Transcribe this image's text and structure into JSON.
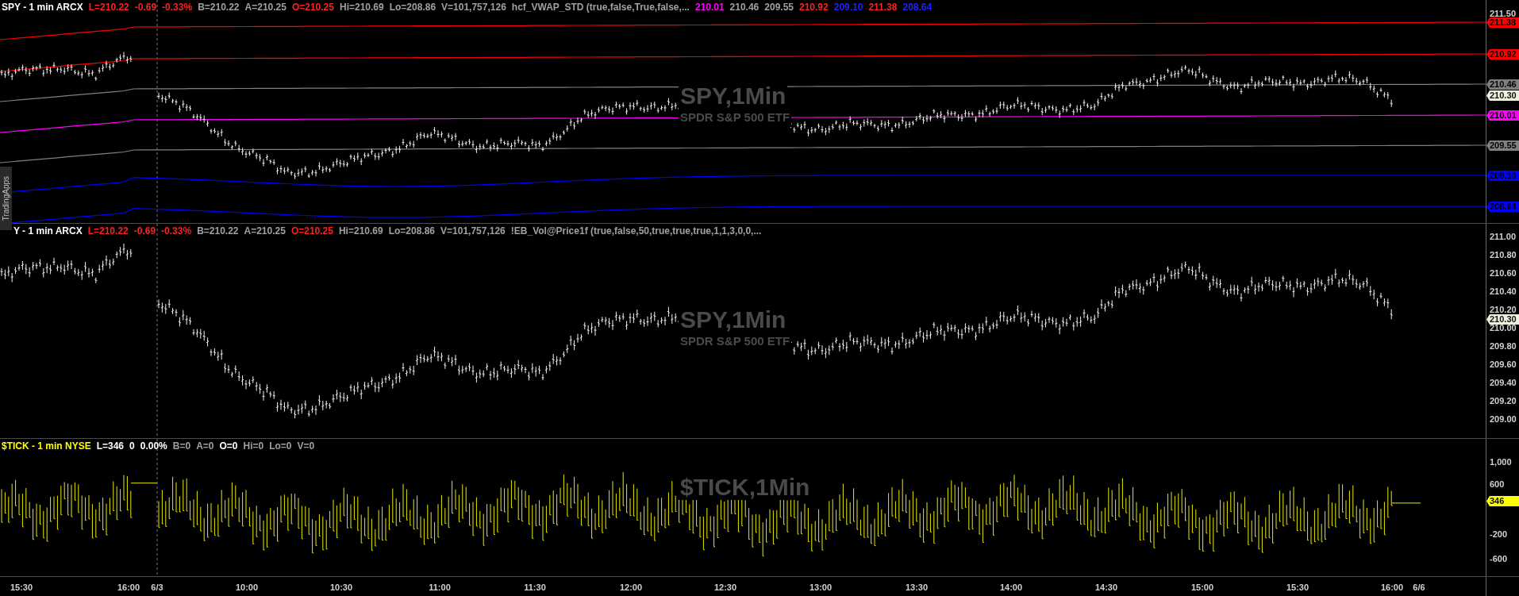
{
  "side_tab": "TradingApps",
  "panels": [
    {
      "header": [
        {
          "text": "SPY - 1 min  ARCX",
          "color": "#ffffff"
        },
        {
          "text": "L=210.22",
          "color": "#ff2020"
        },
        {
          "text": "-0.69",
          "color": "#ff2020"
        },
        {
          "text": "-0.33%",
          "color": "#ff2020"
        },
        {
          "text": "B=210.22",
          "color": "#a0a0a0"
        },
        {
          "text": "A=210.25",
          "color": "#a0a0a0"
        },
        {
          "text": "O=210.25",
          "color": "#ff2020"
        },
        {
          "text": "Hi=210.69",
          "color": "#a0a0a0"
        },
        {
          "text": "Lo=208.86",
          "color": "#a0a0a0"
        },
        {
          "text": "V=101,757,126",
          "color": "#a0a0a0"
        },
        {
          "text": "hcf_VWAP_STD (true,false,True,false,...",
          "color": "#a0a0a0"
        },
        {
          "text": "210.01",
          "color": "#ff00ff"
        },
        {
          "text": "210.46",
          "color": "#a0a0a0"
        },
        {
          "text": "209.55",
          "color": "#a0a0a0"
        },
        {
          "text": "210.92",
          "color": "#ff2020"
        },
        {
          "text": "209.10",
          "color": "#2020ff"
        },
        {
          "text": "211.38",
          "color": "#ff2020"
        },
        {
          "text": "208.64",
          "color": "#2020ff"
        }
      ],
      "watermark": {
        "symbol": "SPY,1Min",
        "description": "SPDR S&P 500 ETF"
      },
      "axis_labels": [
        "211.50"
      ],
      "price_tags": [
        {
          "text": "211.38",
          "color": "#ff0000",
          "kind": "band"
        },
        {
          "text": "210.92",
          "color": "#ff0000",
          "kind": "band"
        },
        {
          "text": "210.46",
          "color": "#808080",
          "kind": "band"
        },
        {
          "text": "210.30",
          "color": "#f0f0e0",
          "kind": "last"
        },
        {
          "text": "210.01",
          "color": "#ff00ff",
          "kind": "band"
        },
        {
          "text": "209.55",
          "color": "#808080",
          "kind": "band"
        },
        {
          "text": "209.10",
          "color": "#0000ff",
          "kind": "band"
        },
        {
          "text": "208.64",
          "color": "#0000ff",
          "kind": "band"
        }
      ]
    },
    {
      "header": [
        {
          "text": "Y - 1 min  ARCX",
          "color": "#ffffff"
        },
        {
          "text": "L=210.22",
          "color": "#ff2020"
        },
        {
          "text": "-0.69",
          "color": "#ff2020"
        },
        {
          "text": "-0.33%",
          "color": "#ff2020"
        },
        {
          "text": "B=210.22",
          "color": "#a0a0a0"
        },
        {
          "text": "A=210.25",
          "color": "#a0a0a0"
        },
        {
          "text": "O=210.25",
          "color": "#ff2020"
        },
        {
          "text": "Hi=210.69",
          "color": "#a0a0a0"
        },
        {
          "text": "Lo=208.86",
          "color": "#a0a0a0"
        },
        {
          "text": "V=101,757,126",
          "color": "#a0a0a0"
        },
        {
          "text": "!EB_Vol@Price1f (true,false,50,true,true,true,1,1,3,0,0,...",
          "color": "#a0a0a0"
        }
      ],
      "watermark": {
        "symbol": "SPY,1Min",
        "description": "SPDR S&P 500 ETF"
      },
      "axis_labels": [
        "211.00",
        "210.80",
        "210.60",
        "210.40",
        "210.20",
        "210.00",
        "209.80",
        "209.60",
        "209.40",
        "209.20",
        "209.00"
      ],
      "price_tags": [
        {
          "text": "210.30",
          "color": "#f0f0e0",
          "kind": "last"
        }
      ]
    },
    {
      "header": [
        {
          "text": "$TICK - 1 min  NYSE",
          "color": "#ffff00"
        },
        {
          "text": "L=346",
          "color": "#ffffff"
        },
        {
          "text": "0",
          "color": "#ffffff"
        },
        {
          "text": "0.00%",
          "color": "#ffffff"
        },
        {
          "text": "B=0",
          "color": "#a0a0a0"
        },
        {
          "text": "A=0",
          "color": "#a0a0a0"
        },
        {
          "text": "O=0",
          "color": "#ffffff"
        },
        {
          "text": "Hi=0",
          "color": "#a0a0a0"
        },
        {
          "text": "Lo=0",
          "color": "#a0a0a0"
        },
        {
          "text": "V=0",
          "color": "#a0a0a0"
        }
      ],
      "watermark": {
        "symbol": "$TICK,1Min"
      },
      "axis_labels": [
        "1,000",
        "600",
        "-200",
        "-600"
      ],
      "price_tags": [
        {
          "text": "346",
          "color": "#ffff00",
          "kind": "last"
        }
      ]
    }
  ],
  "time_axis": [
    "15:30",
    "16:00",
    "6/3",
    "10:00",
    "10:30",
    "11:00",
    "11:30",
    "12:00",
    "12:30",
    "13:00",
    "13:30",
    "14:00",
    "14:30",
    "15:00",
    "15:30",
    "16:00",
    "6/6"
  ]
}
